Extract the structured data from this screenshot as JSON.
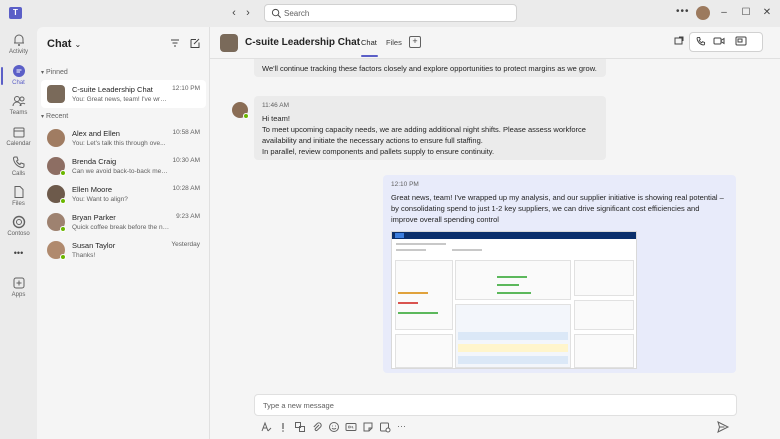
{
  "app": {
    "logo": "T",
    "search_placeholder": "Search",
    "more_label": "•••"
  },
  "rail": [
    {
      "label": "Activity",
      "icon": "bell-icon"
    },
    {
      "label": "Chat",
      "icon": "chat-icon",
      "active": true
    },
    {
      "label": "Teams",
      "icon": "teams-icon"
    },
    {
      "label": "Calendar",
      "icon": "calendar-icon"
    },
    {
      "label": "Calls",
      "icon": "phone-icon"
    },
    {
      "label": "Files",
      "icon": "file-icon"
    },
    {
      "label": "Contoso",
      "icon": "contoso-icon"
    },
    {
      "label": "•••",
      "icon": "more-icon"
    },
    {
      "label": "Apps",
      "icon": "apps-icon"
    }
  ],
  "chatlist": {
    "title": "Chat",
    "pinned_label": "Pinned",
    "recent_label": "Recent",
    "pinned": [
      {
        "name": "C-suite Leadership Chat",
        "preview": "You: Great news, team! I've wrap...",
        "time": "12:10 PM"
      }
    ],
    "recent": [
      {
        "name": "Alex and Ellen",
        "preview": "You: Let's talk this through ove...",
        "time": "10:58 AM"
      },
      {
        "name": "Brenda Craig",
        "preview": "Can we avoid back-to-back meet...",
        "time": "10:30 AM"
      },
      {
        "name": "Ellen Moore",
        "preview": "You: Want to align?",
        "time": "10:28 AM"
      },
      {
        "name": "Bryan Parker",
        "preview": "Quick coffee break before the ne...",
        "time": "9:23 AM"
      },
      {
        "name": "Susan Taylor",
        "preview": "Thanks!",
        "time": "Yesterday"
      }
    ]
  },
  "chat": {
    "title": "C-suite Leadership Chat",
    "tabs": [
      "Chat",
      "Files"
    ],
    "messages": [
      {
        "text": "We'll continue tracking these factors closely and explore opportunities to protect margins as we grow."
      },
      {
        "time": "11:46 AM",
        "lines": [
          "Hi team!",
          "To meet upcoming capacity needs, we are adding additional night shifts. Please assess workforce",
          "availability and initiate the necessary actions to ensure full staffing.",
          "In parallel, review components and pallets supply to ensure continuity."
        ]
      },
      {
        "time": "12:10 PM",
        "lines": [
          "Great news, team! I've wrapped up my analysis, and our supplier initiative is showing real potential –",
          "by consolidating spend to just 1-2 key suppliers, we can drive significant cost efficiencies and",
          "improve overall spending control"
        ]
      }
    ],
    "compose_placeholder": "Type a new message"
  }
}
